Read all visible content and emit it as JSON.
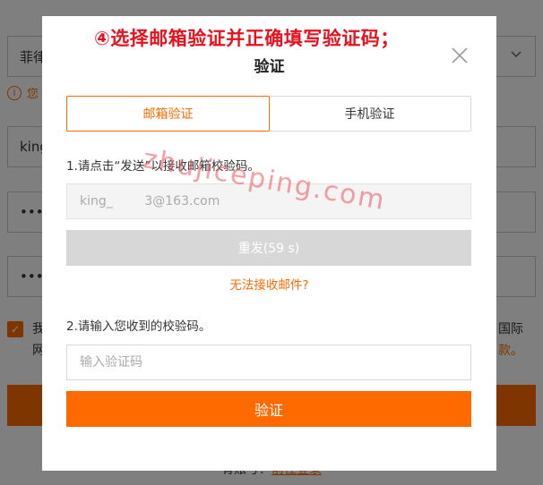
{
  "background": {
    "country_value": "菲律",
    "note_icon": "info-icon",
    "note_text": "您",
    "username_value": "king",
    "password_dots": "•••••",
    "confirm_dots": "•••••",
    "agree_left_line1": "我",
    "agree_left_line2": "网",
    "agree_right_line1": "国际",
    "agree_right_line2": "款。",
    "footer_text": "有账号？",
    "footer_link": "前往登录"
  },
  "modal": {
    "annotation": "④选择邮箱验证并正确填写验证码；",
    "title": "验证",
    "close_icon": "close-icon",
    "tabs": [
      {
        "label": "邮箱验证",
        "active": true
      },
      {
        "label": "手机验证",
        "active": false
      }
    ],
    "step1": "1.请点击“发送”以接收邮箱校验码。",
    "email_value": "king_        3@163.com",
    "resend_label": "重发(59 s)",
    "no_mail_link": "无法接收邮件?",
    "step2": "2.请输入您收到的校验码。",
    "code_placeholder": "输入验证码",
    "verify_label": "验证",
    "watermark": "zhujiceping.com"
  },
  "colors": {
    "accent": "#ff6a00",
    "annotation_red": "#e8111d",
    "disabled_gray": "#d7d7d7"
  }
}
